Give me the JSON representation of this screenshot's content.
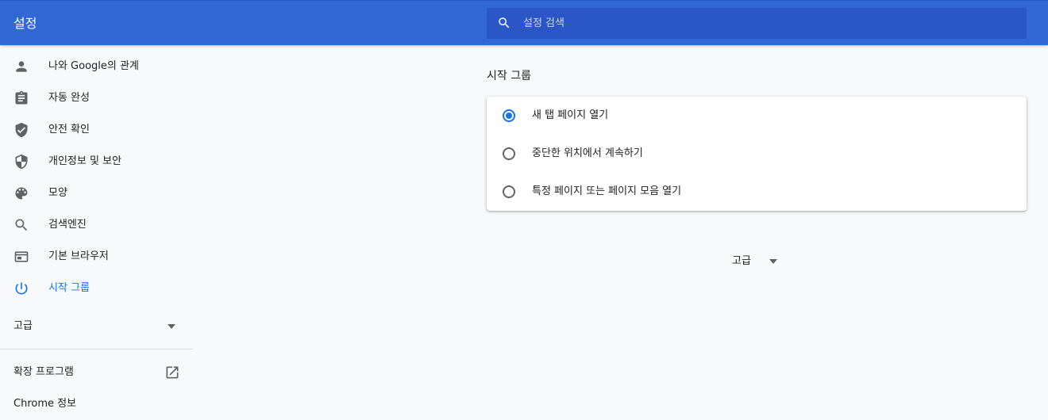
{
  "header": {
    "title": "설정",
    "search_placeholder": "설정 검색"
  },
  "sidebar": {
    "items": [
      {
        "label": "나와 Google의 관계",
        "icon": "person-icon"
      },
      {
        "label": "자동 완성",
        "icon": "clipboard-icon"
      },
      {
        "label": "안전 확인",
        "icon": "shield-check-icon"
      },
      {
        "label": "개인정보 및 보안",
        "icon": "shield-half-icon"
      },
      {
        "label": "모양",
        "icon": "palette-icon"
      },
      {
        "label": "검색엔진",
        "icon": "search-icon"
      },
      {
        "label": "기본 브라우저",
        "icon": "browser-window-icon"
      },
      {
        "label": "시작 그룹",
        "icon": "power-icon",
        "active": true
      }
    ],
    "advanced_label": "고급",
    "extensions_label": "확장 프로그램",
    "about_label": "Chrome 정보"
  },
  "main": {
    "section_title": "시작 그룹",
    "options": [
      {
        "label": "새 탭 페이지 열기",
        "checked": true
      },
      {
        "label": "중단한 위치에서 계속하기",
        "checked": false
      },
      {
        "label": "특정 페이지 또는 페이지 모음 열기",
        "checked": false
      }
    ],
    "advanced_label": "고급"
  },
  "colors": {
    "header_bg": "#3367d6",
    "search_bg": "#2a56c6",
    "accent": "#1a73e8",
    "page_bg": "#f8f9fa"
  }
}
